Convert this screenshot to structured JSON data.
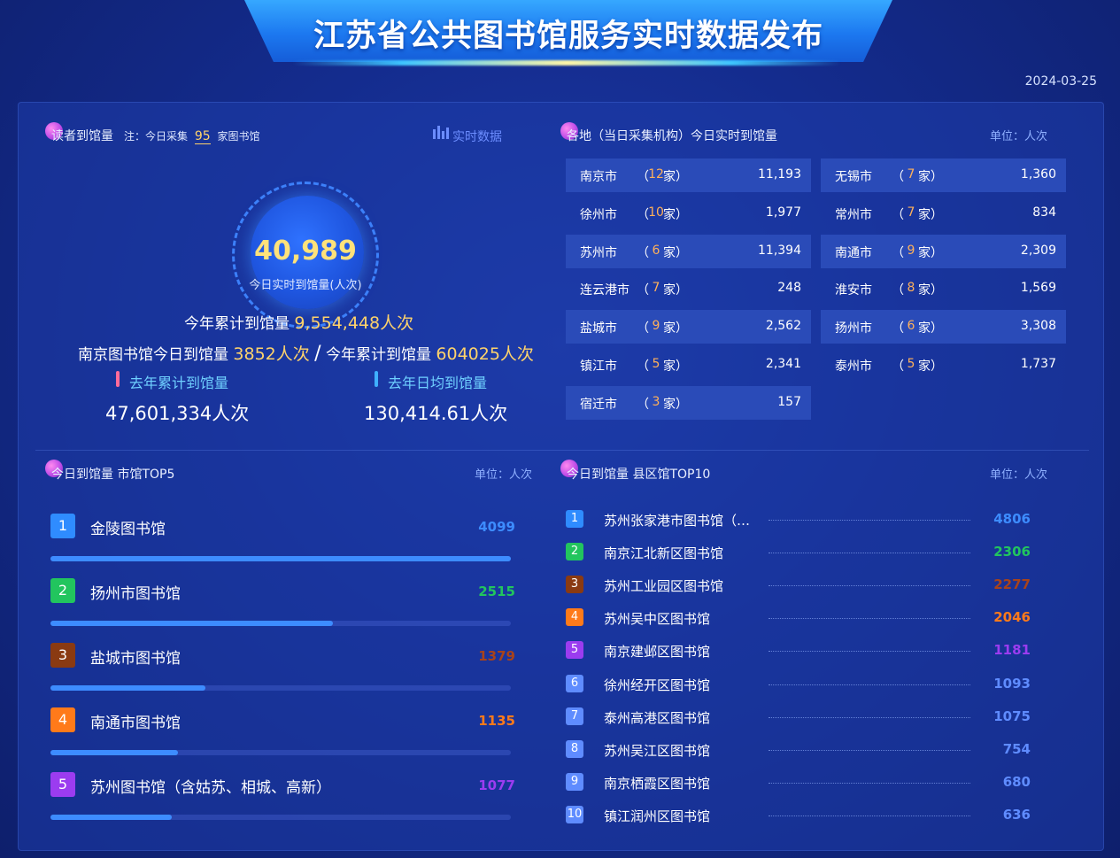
{
  "header": {
    "title": "江苏省公共图书馆服务实时数据发布",
    "date": "2024-03-25"
  },
  "reader_section": {
    "title": "读者到馆量",
    "note_prefix": "注：今日采集",
    "note_count": "95",
    "note_suffix": "家图书馆",
    "realtime_link": "实时数据",
    "today_number": "40,989",
    "today_caption": "今日实时到馆量(人次)",
    "year_label": "今年累计到馆量",
    "year_value": "9,554,448人次",
    "nanjing_today_label": "南京图书馆今日到馆量",
    "nanjing_today_value": "3852人次",
    "separator": "/",
    "nanjing_year_label": "今年累计到馆量",
    "nanjing_year_value": "604025人次",
    "last_year_total_label": "去年累计到馆量",
    "last_year_total_value": "47,601,334人次",
    "last_year_avg_label": "去年日均到馆量",
    "last_year_avg_value": "130,414.61人次"
  },
  "city_section": {
    "title": "各地（当日采集机构）今日实时到馆量",
    "unit": "单位：人次",
    "left": [
      {
        "city": "南京市",
        "count": "12",
        "value": "11,193"
      },
      {
        "city": "徐州市",
        "count": "10",
        "value": "1,977"
      },
      {
        "city": "苏州市",
        "count": "6",
        "value": "11,394"
      },
      {
        "city": "连云港市",
        "count": "7",
        "value": "248"
      },
      {
        "city": "盐城市",
        "count": "9",
        "value": "2,562"
      },
      {
        "city": "镇江市",
        "count": "5",
        "value": "2,341"
      },
      {
        "city": "宿迁市",
        "count": "3",
        "value": "157"
      }
    ],
    "right": [
      {
        "city": "无锡市",
        "count": "7",
        "value": "1,360"
      },
      {
        "city": "常州市",
        "count": "7",
        "value": "834"
      },
      {
        "city": "南通市",
        "count": "9",
        "value": "2,309"
      },
      {
        "city": "淮安市",
        "count": "8",
        "value": "1,569"
      },
      {
        "city": "扬州市",
        "count": "6",
        "value": "3,308"
      },
      {
        "city": "泰州市",
        "count": "5",
        "value": "1,737"
      }
    ],
    "paren_open": "（",
    "paren_close": "家）"
  },
  "top5_section": {
    "title": "今日到馆量 市馆TOP5",
    "unit": "单位：人次",
    "items": [
      {
        "rank": "1",
        "name": "金陵图书馆",
        "value": "4099",
        "share": 1.0
      },
      {
        "rank": "2",
        "name": "扬州市图书馆",
        "value": "2515",
        "share": 0.614
      },
      {
        "rank": "3",
        "name": "盐城市图书馆",
        "value": "1379",
        "share": 0.336
      },
      {
        "rank": "4",
        "name": "南通市图书馆",
        "value": "1135",
        "share": 0.277
      },
      {
        "rank": "5",
        "name": "苏州图书馆（含姑苏、相城、高新）",
        "value": "1077",
        "share": 0.263
      }
    ]
  },
  "top10_section": {
    "title": "今日到馆量 县区馆TOP10",
    "unit": "单位：人次",
    "items": [
      {
        "rank": "1",
        "name": "苏州张家港市图书馆（含…",
        "value": "4806"
      },
      {
        "rank": "2",
        "name": "南京江北新区图书馆",
        "value": "2306"
      },
      {
        "rank": "3",
        "name": "苏州工业园区图书馆",
        "value": "2277"
      },
      {
        "rank": "4",
        "name": "苏州吴中区图书馆",
        "value": "2046"
      },
      {
        "rank": "5",
        "name": "南京建邺区图书馆",
        "value": "1181"
      },
      {
        "rank": "6",
        "name": "徐州经开区图书馆",
        "value": "1093"
      },
      {
        "rank": "7",
        "name": "泰州高港区图书馆",
        "value": "1075"
      },
      {
        "rank": "8",
        "name": "苏州吴江区图书馆",
        "value": "754"
      },
      {
        "rank": "9",
        "name": "南京栖霞区图书馆",
        "value": "680"
      },
      {
        "rank": "10",
        "name": "镇江润州区图书馆",
        "value": "636"
      }
    ]
  },
  "colors": {
    "rank1": "#2f8cff",
    "rank2": "#22c55e",
    "rank3": "#8a3a12",
    "rank4": "#ff7a1a",
    "rank5": "#9b3cf0",
    "rank_other": "#5f8cff",
    "accent_yellow": "#ffd36b"
  }
}
